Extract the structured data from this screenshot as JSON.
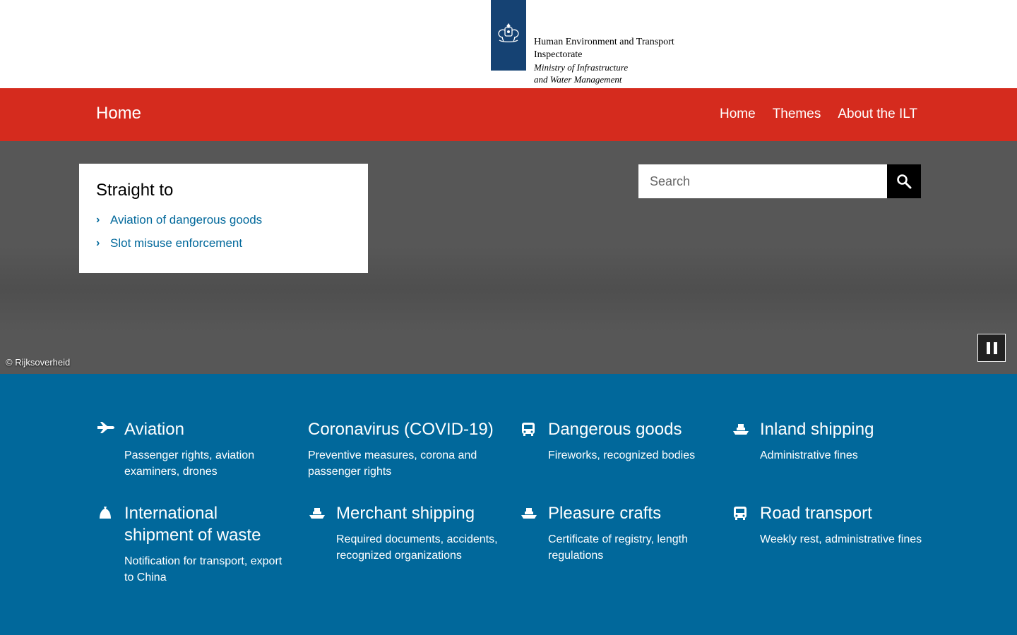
{
  "header": {
    "org_line1": "Human Environment and Transport",
    "org_line2": "Inspectorate",
    "ministry_line1": "Ministry of Infrastructure",
    "ministry_line2": "and Water Management",
    "logo_color": "#154273"
  },
  "navbar": {
    "title": "Home",
    "links": [
      {
        "label": "Home"
      },
      {
        "label": "Themes"
      },
      {
        "label": "About the ILT"
      }
    ],
    "color": "#d52b1e"
  },
  "hero": {
    "straight_to": {
      "title": "Straight to",
      "items": [
        {
          "label": "Aviation of dangerous goods"
        },
        {
          "label": "Slot misuse enforcement"
        }
      ]
    },
    "search": {
      "placeholder": "Search"
    },
    "credit": "© Rijksoverheid",
    "pause_label": "pause"
  },
  "themes": {
    "color": "#01689b",
    "items": [
      {
        "title": "Aviation",
        "desc": "Passenger rights, aviation examiners, drones",
        "icon": "airplane-icon"
      },
      {
        "title": "Coronavirus (COVID-19)",
        "desc": "Preventive measures, corona and passenger rights",
        "icon": ""
      },
      {
        "title": "Dangerous goods",
        "desc": "Fireworks, recognized bodies",
        "icon": "truck-icon"
      },
      {
        "title": "Inland shipping",
        "desc": "Administrative fines",
        "icon": "ship-icon"
      },
      {
        "title": "International shipment of waste",
        "desc": "Notification for transport, export to China",
        "icon": "waste-bag-icon"
      },
      {
        "title": "Merchant shipping",
        "desc": "Required documents, accidents, recognized organizations",
        "icon": "ship-icon"
      },
      {
        "title": "Pleasure crafts",
        "desc": "Certificate of registry, length regulations",
        "icon": "ship-icon"
      },
      {
        "title": "Road transport",
        "desc": "Weekly rest, administrative fines",
        "icon": "truck-icon"
      }
    ]
  }
}
